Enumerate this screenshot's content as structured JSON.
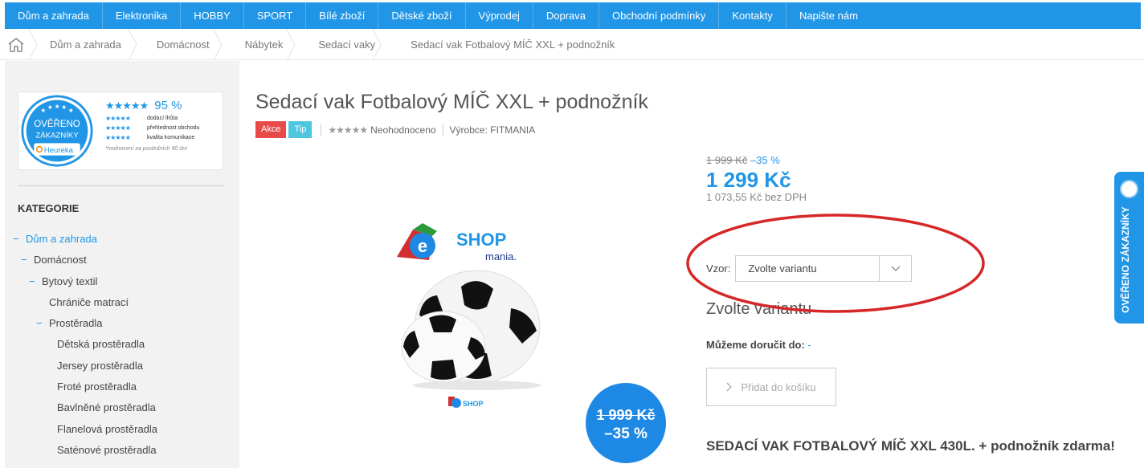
{
  "nav": {
    "items": [
      "Dům a zahrada",
      "Elektronika",
      "HOBBY",
      "SPORT",
      "Bílé zboží",
      "Dětské zboží",
      "Výprodej",
      "Doprava",
      "Obchodní podmínky",
      "Kontakty",
      "Napište nám"
    ]
  },
  "breadcrumb": {
    "items": [
      "Dům a zahrada",
      "Domácnost",
      "Nábytek",
      "Sedací vaky",
      "Sedací vak Fotbalový MÍČ XXL + podnožník"
    ]
  },
  "heureka": {
    "badge_line1": "OVĚŘENO",
    "badge_line2": "ZÁKAZNÍKY",
    "badge_brand": "Heureka",
    "percent": "95 %",
    "rows": [
      "dodací lhůta",
      "přehlednost obchodu",
      "kvalita komunikace"
    ],
    "note": "*hodnocení za posledních 90 dní"
  },
  "sidebar": {
    "title": "KATEGORIE",
    "items": [
      {
        "label": "Dům a zahrada",
        "dash": "−",
        "level": 0,
        "active": true
      },
      {
        "label": "Domácnost",
        "dash": "−",
        "level": 1,
        "active": false
      },
      {
        "label": "Bytový textil",
        "dash": "−",
        "level": 2,
        "active": false
      },
      {
        "label": "Chrániče matrací",
        "dash": "",
        "level": 3,
        "active": false
      },
      {
        "label": "Prostěradla",
        "dash": "−",
        "level": 3,
        "active": false
      },
      {
        "label": "Dětská prostěradla",
        "dash": "",
        "level": 4,
        "active": false
      },
      {
        "label": "Jersey prostěradla",
        "dash": "",
        "level": 4,
        "active": false
      },
      {
        "label": "Froté prostěradla",
        "dash": "",
        "level": 4,
        "active": false
      },
      {
        "label": "Bavlněné prostěradla",
        "dash": "",
        "level": 4,
        "active": false
      },
      {
        "label": "Flanelová prostěradla",
        "dash": "",
        "level": 4,
        "active": false
      },
      {
        "label": "Saténové prostěradla",
        "dash": "",
        "level": 4,
        "active": false
      }
    ]
  },
  "product": {
    "title": "Sedací vak Fotbalový MÍČ XXL + podnožník",
    "tag_akce": "Akce",
    "tag_tip": "Tip",
    "rating_text": "Neohodnoceno",
    "manufacturer": "Výrobce: FITMANIA",
    "logo_text": "SHOP",
    "logo_sub": "mania.",
    "logo_small": "SHOP"
  },
  "price": {
    "old": "1 999 Kč",
    "discount": "–35 %",
    "new": "1 299 Kč",
    "without_vat": "1 073,55 Kč bez DPH"
  },
  "sale_badge": {
    "old": "1 999 Kč",
    "pct": "–35 %"
  },
  "variant": {
    "label": "Vzor:",
    "placeholder": "Zvolte variantu",
    "heading": "Zvolte variantu"
  },
  "delivery": {
    "label": "Můžeme doručit do:",
    "value": "-"
  },
  "cart": {
    "label": "Přidat do košíku"
  },
  "promo": {
    "text": "SEDACÍ VAK FOTBALOVÝ MÍČ XXL 430L. + podnožník zdarma!"
  },
  "side_tab": {
    "label": "OVĚŘENO ZÁKAZNÍKY"
  },
  "colors": {
    "accent": "#2196e6",
    "akce": "#e84a4a",
    "tip": "#4fc6e0",
    "annotation": "#d62728"
  }
}
